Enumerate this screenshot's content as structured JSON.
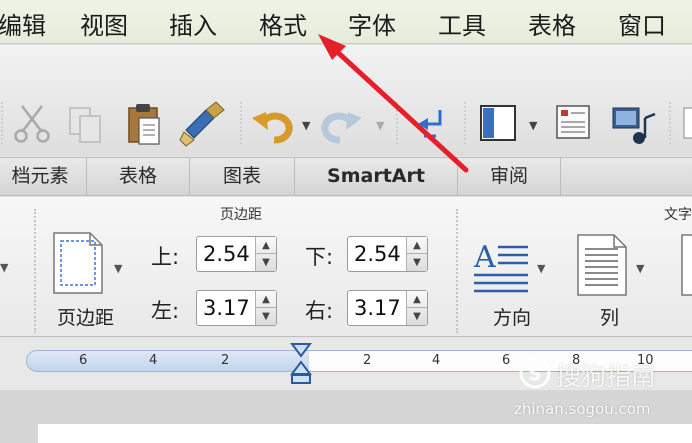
{
  "menu": {
    "items": [
      "编辑",
      "视图",
      "插入",
      "格式",
      "字体",
      "工具",
      "表格",
      "窗口"
    ]
  },
  "ribbon_tabs": [
    "档元素",
    "表格",
    "图表",
    "SmartArt",
    "审阅"
  ],
  "groups": {
    "margins_title": "页边距",
    "text_title": "文字"
  },
  "margins": {
    "button_label": "页边距",
    "top_label": "上:",
    "top_value": "2.54",
    "bottom_label": "下:",
    "bottom_value": "2.54",
    "left_label": "左:",
    "left_value": "3.17",
    "right_label": "右:",
    "right_value": "3.17"
  },
  "text_group": {
    "direction_label": "方向",
    "columns_label": "列"
  },
  "ruler": {
    "ticks": [
      "6",
      "4",
      "2",
      "2",
      "4",
      "6",
      "8",
      "10"
    ]
  },
  "watermark": {
    "brand": "搜狗指南",
    "url": "zhinan.sogou.com"
  },
  "colors": {
    "arrow": "#e5202a",
    "menu_bg": "#eaefdf",
    "ruler_blue": "#c8d9ee"
  }
}
